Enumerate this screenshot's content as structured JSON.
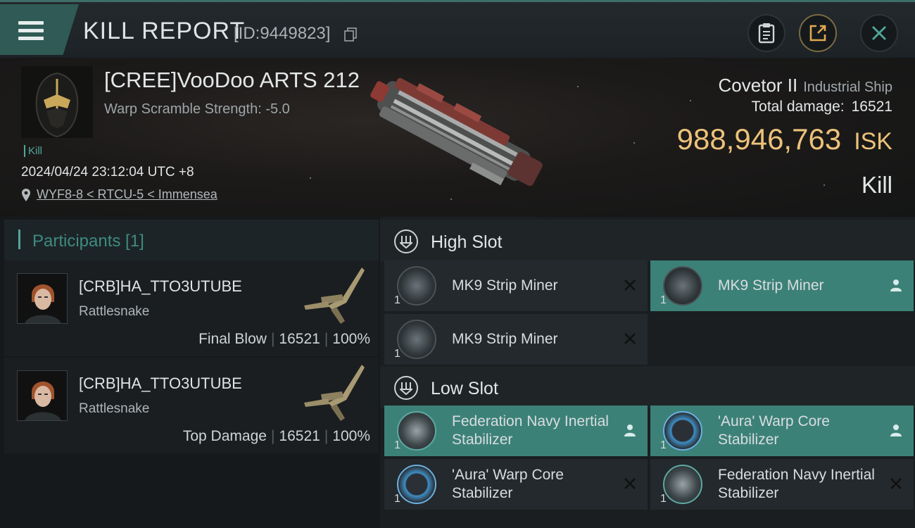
{
  "header": {
    "title": "KILL REPORT",
    "report_id": "[ID:9449823]"
  },
  "victim": {
    "name": "[CREE]VooDoo ARTS 212",
    "warp_scramble": "Warp Scramble Strength: -5.0",
    "tag": "Kill",
    "datetime": "2024/04/24 23:12:04 UTC +8",
    "location": "WYF8-8 < RTCU-5 < Immensea"
  },
  "ship": {
    "name": "Covetor II",
    "class": "Industrial Ship",
    "total_damage_label": "Total damage:",
    "total_damage_value": "16521",
    "isk_value": "988,946,763",
    "isk_unit": "ISK",
    "result": "Kill"
  },
  "participants": {
    "header": "Participants [1]",
    "rows": [
      {
        "name": "[CRB]HA_TTO3UTUBE",
        "ship": "Rattlesnake",
        "role": "Final Blow",
        "damage": "16521",
        "percent": "100%"
      },
      {
        "name": "[CRB]HA_TTO3UTUBE",
        "ship": "Rattlesnake",
        "role": "Top Damage",
        "damage": "16521",
        "percent": "100%"
      }
    ]
  },
  "slots": {
    "high": {
      "title": "High Slot",
      "modules": [
        {
          "name": "MK9 Strip Miner",
          "qty": "1"
        },
        {
          "name": "MK9 Strip Miner",
          "qty": "1"
        },
        {
          "name": "MK9 Strip Miner",
          "qty": "1"
        }
      ]
    },
    "low": {
      "title": "Low Slot",
      "modules": [
        {
          "name": "Federation Navy Inertial Stabilizer",
          "qty": "1"
        },
        {
          "name": "'Aura' Warp Core Stabilizer",
          "qty": "1"
        },
        {
          "name": "'Aura' Warp Core Stabilizer",
          "qty": "1"
        },
        {
          "name": "Federation Navy Inertial Stabilizer",
          "qty": "1"
        }
      ]
    }
  },
  "colors": {
    "accent_teal": "#3c8178",
    "isk_gold": "#ecc27a",
    "header_tab": "#2f5a55"
  }
}
